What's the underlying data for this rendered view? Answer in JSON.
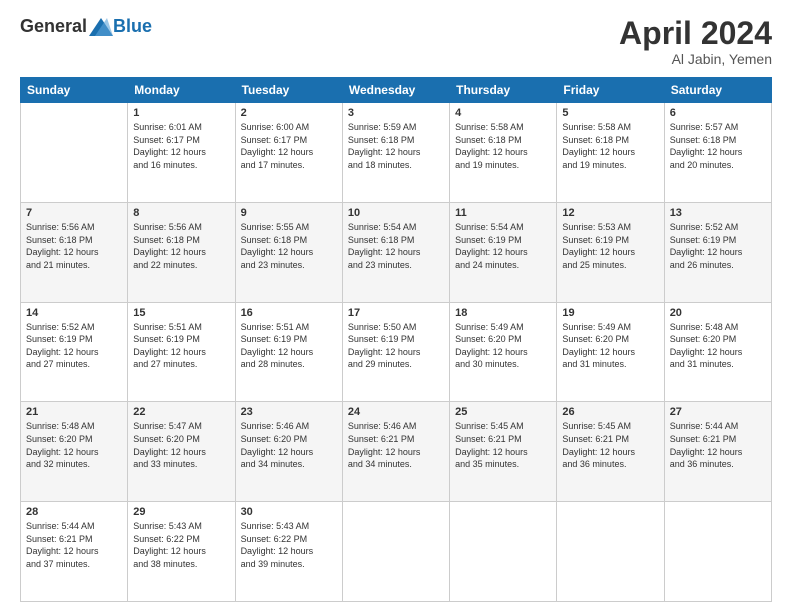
{
  "logo": {
    "general": "General",
    "blue": "Blue"
  },
  "title": "April 2024",
  "location": "Al Jabin, Yemen",
  "days_header": [
    "Sunday",
    "Monday",
    "Tuesday",
    "Wednesday",
    "Thursday",
    "Friday",
    "Saturday"
  ],
  "weeks": [
    [
      {
        "day": "",
        "info": ""
      },
      {
        "day": "1",
        "info": "Sunrise: 6:01 AM\nSunset: 6:17 PM\nDaylight: 12 hours\nand 16 minutes."
      },
      {
        "day": "2",
        "info": "Sunrise: 6:00 AM\nSunset: 6:17 PM\nDaylight: 12 hours\nand 17 minutes."
      },
      {
        "day": "3",
        "info": "Sunrise: 5:59 AM\nSunset: 6:18 PM\nDaylight: 12 hours\nand 18 minutes."
      },
      {
        "day": "4",
        "info": "Sunrise: 5:58 AM\nSunset: 6:18 PM\nDaylight: 12 hours\nand 19 minutes."
      },
      {
        "day": "5",
        "info": "Sunrise: 5:58 AM\nSunset: 6:18 PM\nDaylight: 12 hours\nand 19 minutes."
      },
      {
        "day": "6",
        "info": "Sunrise: 5:57 AM\nSunset: 6:18 PM\nDaylight: 12 hours\nand 20 minutes."
      }
    ],
    [
      {
        "day": "7",
        "info": "Sunrise: 5:56 AM\nSunset: 6:18 PM\nDaylight: 12 hours\nand 21 minutes."
      },
      {
        "day": "8",
        "info": "Sunrise: 5:56 AM\nSunset: 6:18 PM\nDaylight: 12 hours\nand 22 minutes."
      },
      {
        "day": "9",
        "info": "Sunrise: 5:55 AM\nSunset: 6:18 PM\nDaylight: 12 hours\nand 23 minutes."
      },
      {
        "day": "10",
        "info": "Sunrise: 5:54 AM\nSunset: 6:18 PM\nDaylight: 12 hours\nand 23 minutes."
      },
      {
        "day": "11",
        "info": "Sunrise: 5:54 AM\nSunset: 6:19 PM\nDaylight: 12 hours\nand 24 minutes."
      },
      {
        "day": "12",
        "info": "Sunrise: 5:53 AM\nSunset: 6:19 PM\nDaylight: 12 hours\nand 25 minutes."
      },
      {
        "day": "13",
        "info": "Sunrise: 5:52 AM\nSunset: 6:19 PM\nDaylight: 12 hours\nand 26 minutes."
      }
    ],
    [
      {
        "day": "14",
        "info": "Sunrise: 5:52 AM\nSunset: 6:19 PM\nDaylight: 12 hours\nand 27 minutes."
      },
      {
        "day": "15",
        "info": "Sunrise: 5:51 AM\nSunset: 6:19 PM\nDaylight: 12 hours\nand 27 minutes."
      },
      {
        "day": "16",
        "info": "Sunrise: 5:51 AM\nSunset: 6:19 PM\nDaylight: 12 hours\nand 28 minutes."
      },
      {
        "day": "17",
        "info": "Sunrise: 5:50 AM\nSunset: 6:19 PM\nDaylight: 12 hours\nand 29 minutes."
      },
      {
        "day": "18",
        "info": "Sunrise: 5:49 AM\nSunset: 6:20 PM\nDaylight: 12 hours\nand 30 minutes."
      },
      {
        "day": "19",
        "info": "Sunrise: 5:49 AM\nSunset: 6:20 PM\nDaylight: 12 hours\nand 31 minutes."
      },
      {
        "day": "20",
        "info": "Sunrise: 5:48 AM\nSunset: 6:20 PM\nDaylight: 12 hours\nand 31 minutes."
      }
    ],
    [
      {
        "day": "21",
        "info": "Sunrise: 5:48 AM\nSunset: 6:20 PM\nDaylight: 12 hours\nand 32 minutes."
      },
      {
        "day": "22",
        "info": "Sunrise: 5:47 AM\nSunset: 6:20 PM\nDaylight: 12 hours\nand 33 minutes."
      },
      {
        "day": "23",
        "info": "Sunrise: 5:46 AM\nSunset: 6:20 PM\nDaylight: 12 hours\nand 34 minutes."
      },
      {
        "day": "24",
        "info": "Sunrise: 5:46 AM\nSunset: 6:21 PM\nDaylight: 12 hours\nand 34 minutes."
      },
      {
        "day": "25",
        "info": "Sunrise: 5:45 AM\nSunset: 6:21 PM\nDaylight: 12 hours\nand 35 minutes."
      },
      {
        "day": "26",
        "info": "Sunrise: 5:45 AM\nSunset: 6:21 PM\nDaylight: 12 hours\nand 36 minutes."
      },
      {
        "day": "27",
        "info": "Sunrise: 5:44 AM\nSunset: 6:21 PM\nDaylight: 12 hours\nand 36 minutes."
      }
    ],
    [
      {
        "day": "28",
        "info": "Sunrise: 5:44 AM\nSunset: 6:21 PM\nDaylight: 12 hours\nand 37 minutes."
      },
      {
        "day": "29",
        "info": "Sunrise: 5:43 AM\nSunset: 6:22 PM\nDaylight: 12 hours\nand 38 minutes."
      },
      {
        "day": "30",
        "info": "Sunrise: 5:43 AM\nSunset: 6:22 PM\nDaylight: 12 hours\nand 39 minutes."
      },
      {
        "day": "",
        "info": ""
      },
      {
        "day": "",
        "info": ""
      },
      {
        "day": "",
        "info": ""
      },
      {
        "day": "",
        "info": ""
      }
    ]
  ]
}
